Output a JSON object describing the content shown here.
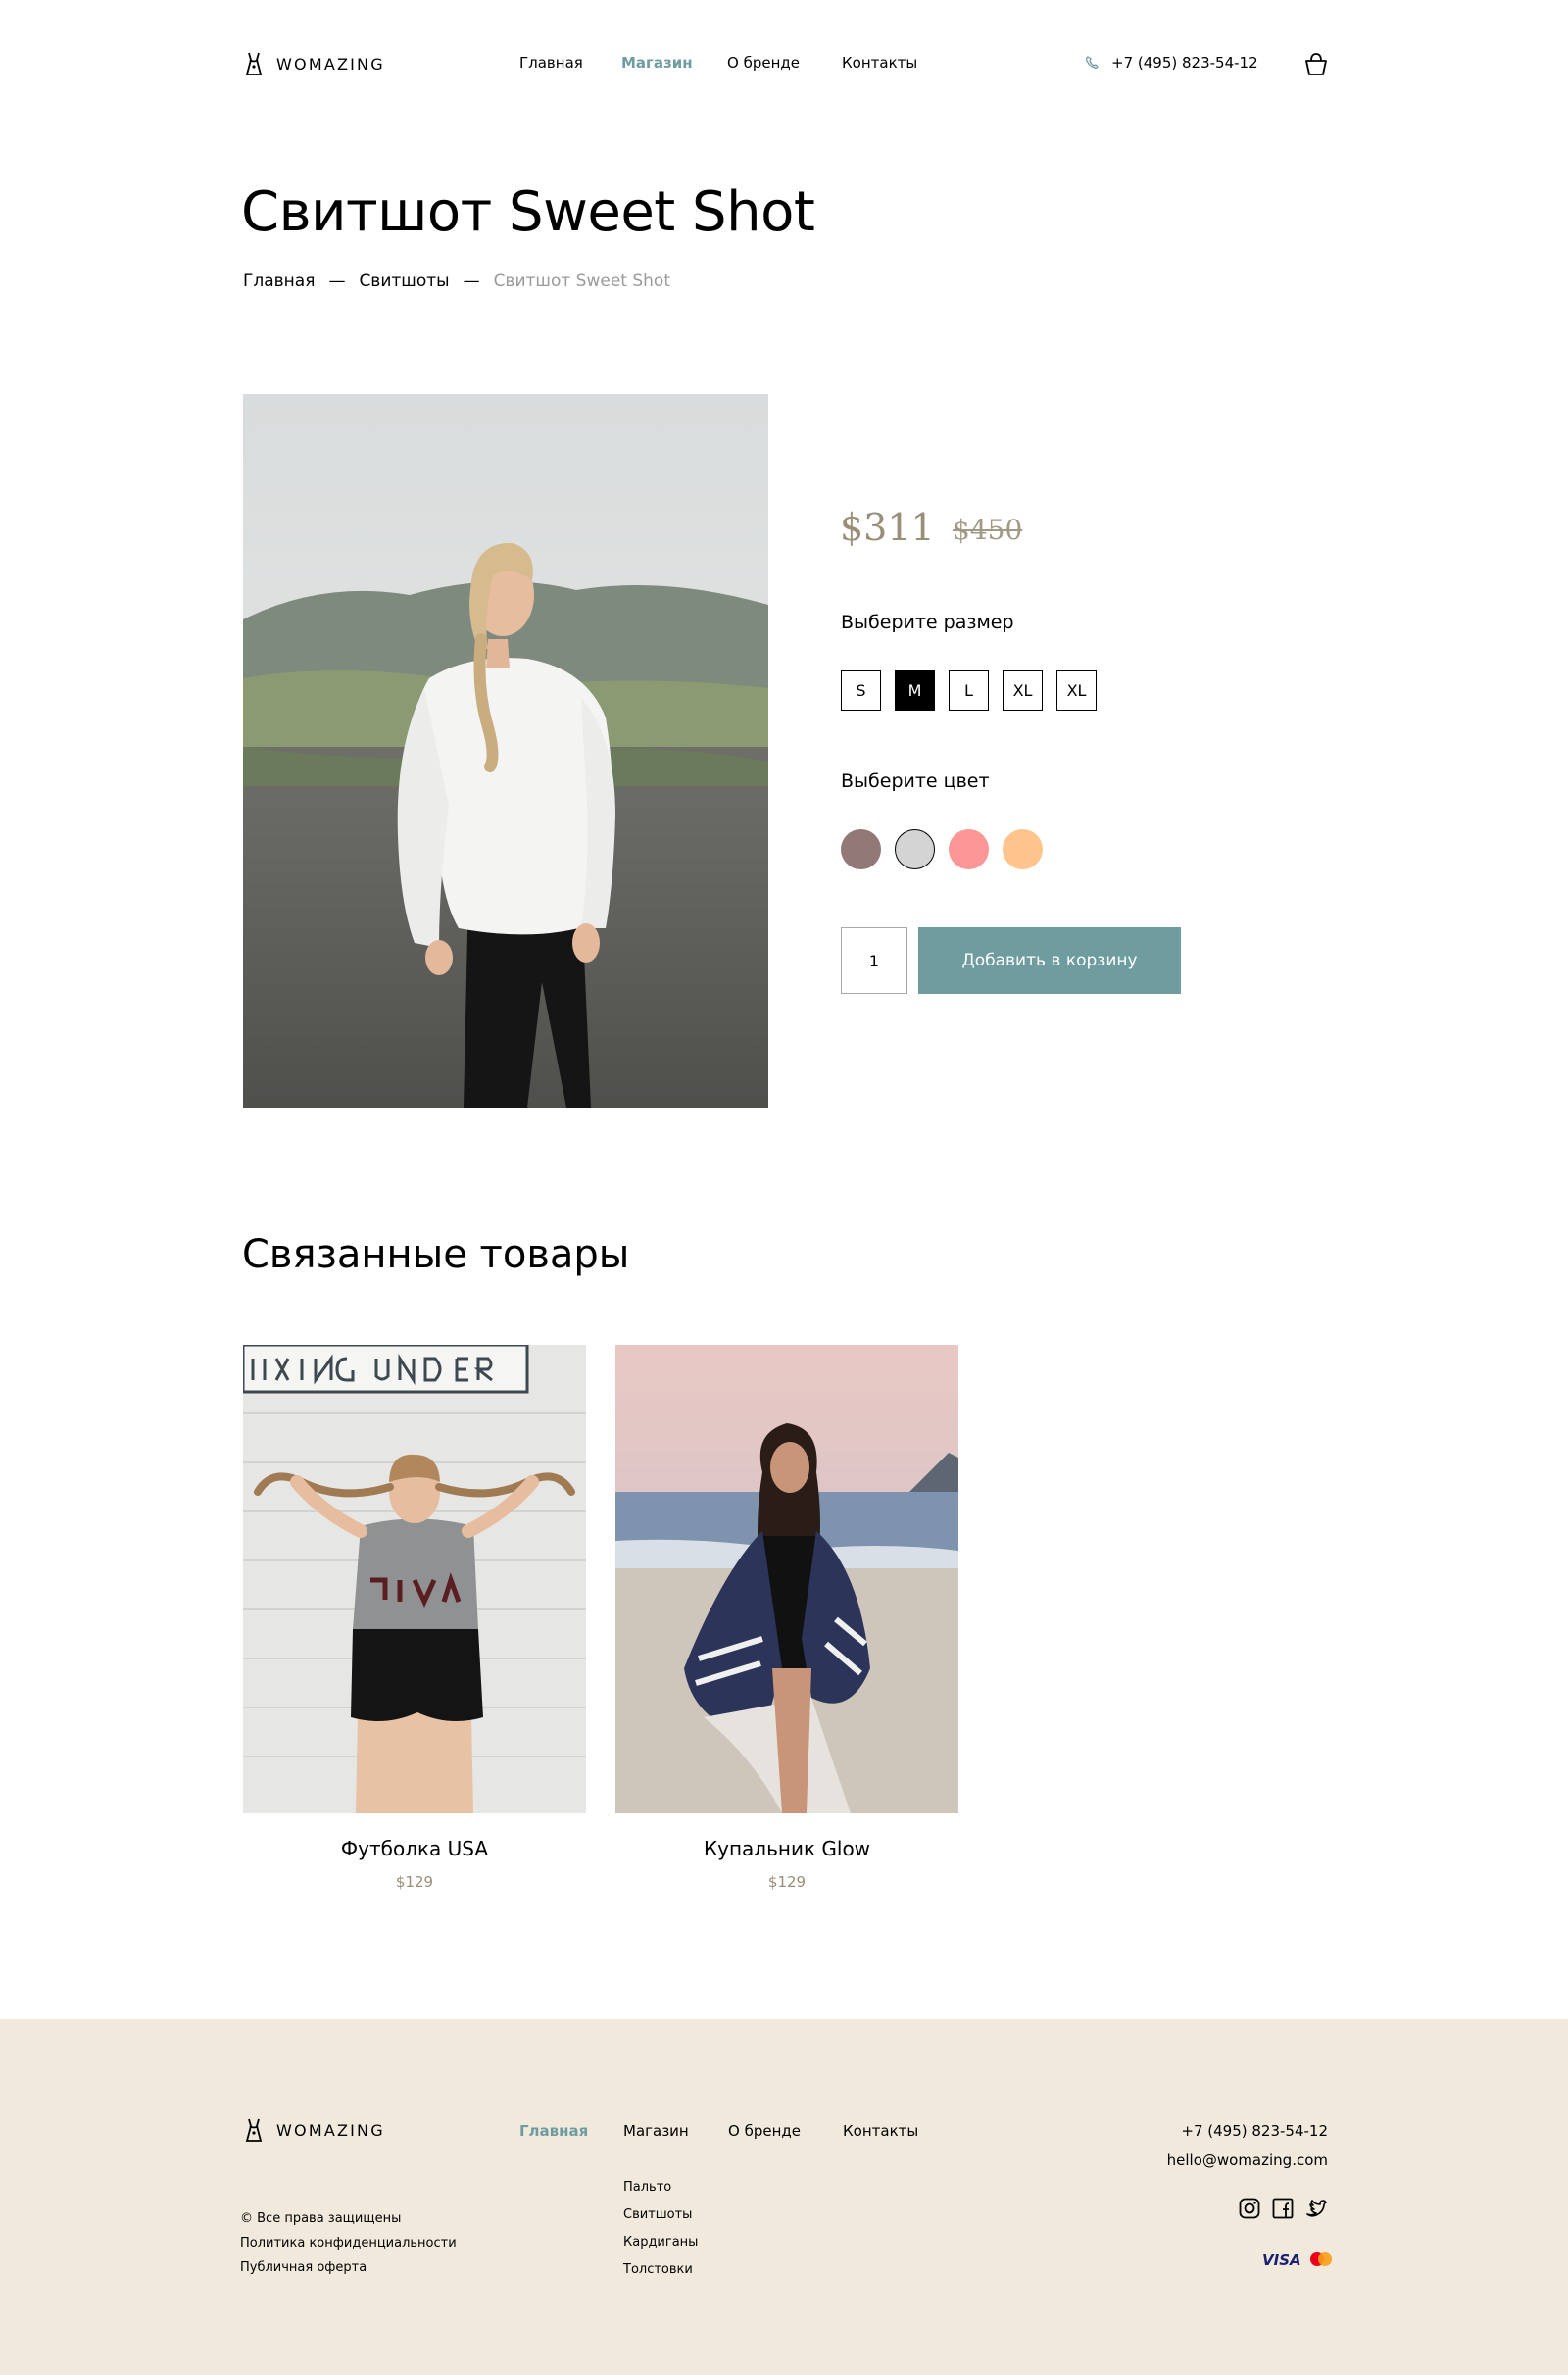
{
  "header": {
    "logo_text": "WOMAZING",
    "nav": [
      {
        "label": "Главная",
        "active": false
      },
      {
        "label": "Магазин",
        "active": true
      },
      {
        "label": "О бренде",
        "active": false
      },
      {
        "label": "Контакты",
        "active": false
      }
    ],
    "phone": "+7 (495) 823-54-12",
    "icons": [
      "logo-icon",
      "phone-icon",
      "cart-icon"
    ]
  },
  "page": {
    "title": "Свитшот Sweet Shot",
    "breadcrumb": [
      "Главная",
      "Свитшоты",
      "Свитшот Sweet Shot"
    ],
    "breadcrumb_separator": "—"
  },
  "product": {
    "price": "$311",
    "old_price": "$450",
    "size_label": "Выберите размер",
    "sizes": [
      {
        "label": "S",
        "selected": false
      },
      {
        "label": "M",
        "selected": true
      },
      {
        "label": "L",
        "selected": false
      },
      {
        "label": "XL",
        "selected": false
      },
      {
        "label": "XL",
        "selected": false
      }
    ],
    "color_label": "Выберите цвет",
    "colors": [
      {
        "hex": "#927876",
        "selected": false
      },
      {
        "hex": "#d4d4d4",
        "selected": true
      },
      {
        "hex": "#fd9696",
        "selected": false
      },
      {
        "hex": "#ffc58c",
        "selected": false
      }
    ],
    "quantity": "1",
    "add_to_cart": "Добавить в корзину"
  },
  "related": {
    "title": "Связанные товары",
    "items": [
      {
        "name": "Футболка USA",
        "price": "$129"
      },
      {
        "name": "Купальник Glow",
        "price": "$129"
      }
    ]
  },
  "footer": {
    "logo_text": "WOMAZING",
    "nav": [
      {
        "label": "Главная",
        "active": true
      },
      {
        "label": "Магазин",
        "active": false
      },
      {
        "label": "О бренде",
        "active": false
      },
      {
        "label": "Контакты",
        "active": false
      }
    ],
    "shop_links": [
      "Пальто",
      "Свитшоты",
      "Кардиганы",
      "Толстовки"
    ],
    "legal": [
      "© Все права защищены",
      "Политика конфиденциальности",
      "Публичная оферта"
    ],
    "phone": "+7 (495) 823-54-12",
    "email": "hello@womazing.com",
    "social_icons": [
      "instagram-icon",
      "facebook-icon",
      "twitter-icon"
    ],
    "payment_icons": [
      "visa-icon",
      "mastercard-icon"
    ],
    "visa_label": "VISA"
  },
  "colors": {
    "accent": "#6e9c9f",
    "price": "#998e78",
    "footer_bg": "#f1eadc"
  }
}
